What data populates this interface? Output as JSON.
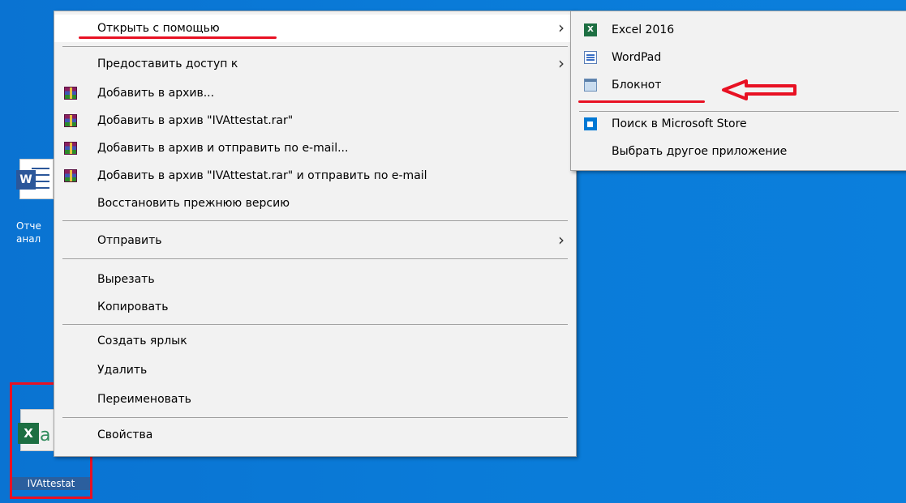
{
  "desktop": {
    "word_icon_label": "Отче\nанал",
    "excel_icon_label": "IVAttestat"
  },
  "context_menu": {
    "items": [
      {
        "label": "Открыть с помощью",
        "has_submenu": true,
        "icon": ""
      },
      {
        "label": "Предоставить доступ к",
        "has_submenu": true,
        "icon": ""
      },
      {
        "label": "Добавить в архив...",
        "has_submenu": false,
        "icon": "winrar-icon"
      },
      {
        "label": "Добавить в архив \"IVAttestat.rar\"",
        "has_submenu": false,
        "icon": "winrar-icon"
      },
      {
        "label": "Добавить в архив и отправить по e-mail...",
        "has_submenu": false,
        "icon": "winrar-icon"
      },
      {
        "label": "Добавить в архив \"IVAttestat.rar\" и отправить по e-mail",
        "has_submenu": false,
        "icon": "winrar-icon"
      },
      {
        "label": "Восстановить прежнюю версию",
        "has_submenu": false,
        "icon": ""
      },
      {
        "label": "Отправить",
        "has_submenu": true,
        "icon": ""
      },
      {
        "label": "Вырезать",
        "has_submenu": false,
        "icon": ""
      },
      {
        "label": "Копировать",
        "has_submenu": false,
        "icon": ""
      },
      {
        "label": "Создать ярлык",
        "has_submenu": false,
        "icon": ""
      },
      {
        "label": "Удалить",
        "has_submenu": false,
        "icon": ""
      },
      {
        "label": "Переименовать",
        "has_submenu": false,
        "icon": ""
      },
      {
        "label": "Свойства",
        "has_submenu": false,
        "icon": ""
      }
    ]
  },
  "open_with_submenu": {
    "items": [
      {
        "label": "Excel 2016",
        "icon": "excel-icon"
      },
      {
        "label": "WordPad",
        "icon": "wordpad-icon"
      },
      {
        "label": "Блокнот",
        "icon": "notepad-icon"
      },
      {
        "label": "Поиск в Microsoft Store",
        "icon": "store-icon"
      },
      {
        "label": "Выбрать другое приложение",
        "icon": ""
      }
    ]
  },
  "colors": {
    "desktop": "#0a78d7",
    "menu_bg": "#f2f2f2",
    "annotation_red": "#e81123"
  }
}
